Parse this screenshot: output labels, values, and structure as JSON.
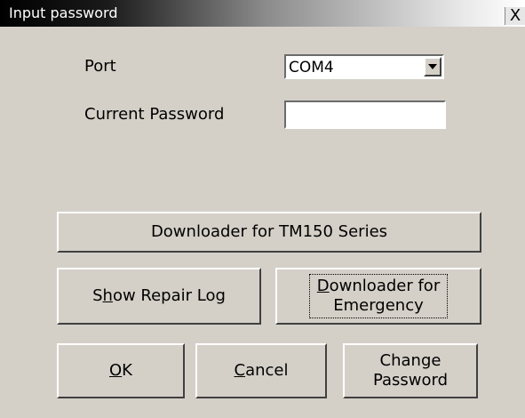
{
  "window": {
    "title": "Input password",
    "close_glyph": "X"
  },
  "port": {
    "label": "Port",
    "value": "COM4"
  },
  "current_password": {
    "label": "Current Password",
    "value": ""
  },
  "buttons": {
    "downloader_tm150": "Downloader for TM150 Series",
    "show_repair_log": {
      "before": "S",
      "mnemonic": "h",
      "after": "ow Repair Log"
    },
    "downloader_emergency": {
      "mnemonic": "D",
      "line1_rest": "ownloader for",
      "line2": "Emergency"
    },
    "ok": {
      "mnemonic": "O",
      "after": "K"
    },
    "cancel": {
      "mnemonic": "C",
      "after": "ancel"
    },
    "change_password": {
      "line1": "Change",
      "line2": "Password"
    }
  }
}
